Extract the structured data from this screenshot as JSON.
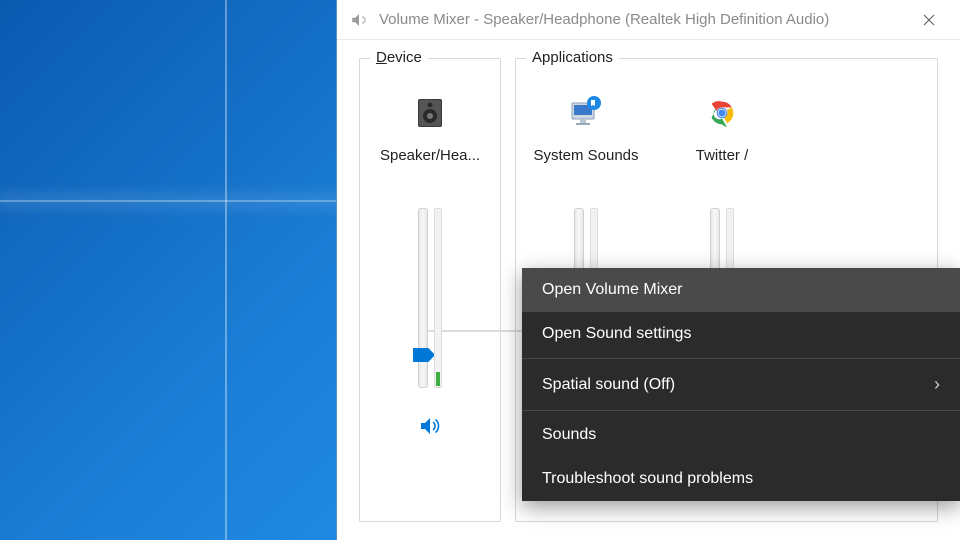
{
  "window": {
    "title": "Volume Mixer - Speaker/Headphone (Realtek High Definition Audio)"
  },
  "groups": {
    "device_label_prefix": "D",
    "device_label_rest": "evice",
    "apps_label": "Applications"
  },
  "channels": {
    "device": {
      "name": "Speaker/Hea...",
      "volume_pct": 18,
      "level_pct": 8
    },
    "system_sounds": {
      "name": "System Sounds",
      "volume_pct": 18,
      "level_pct": 0
    },
    "twitter": {
      "name": "Twitter /",
      "volume_pct": 18,
      "level_pct": 0
    }
  },
  "context_menu": {
    "items": [
      {
        "label": "Open Volume Mixer",
        "highlight": true
      },
      {
        "label": "Open Sound settings"
      },
      {
        "label": "Spatial sound (Off)",
        "submenu": true
      },
      {
        "label": "Sounds"
      },
      {
        "label": "Troubleshoot sound problems"
      }
    ]
  }
}
